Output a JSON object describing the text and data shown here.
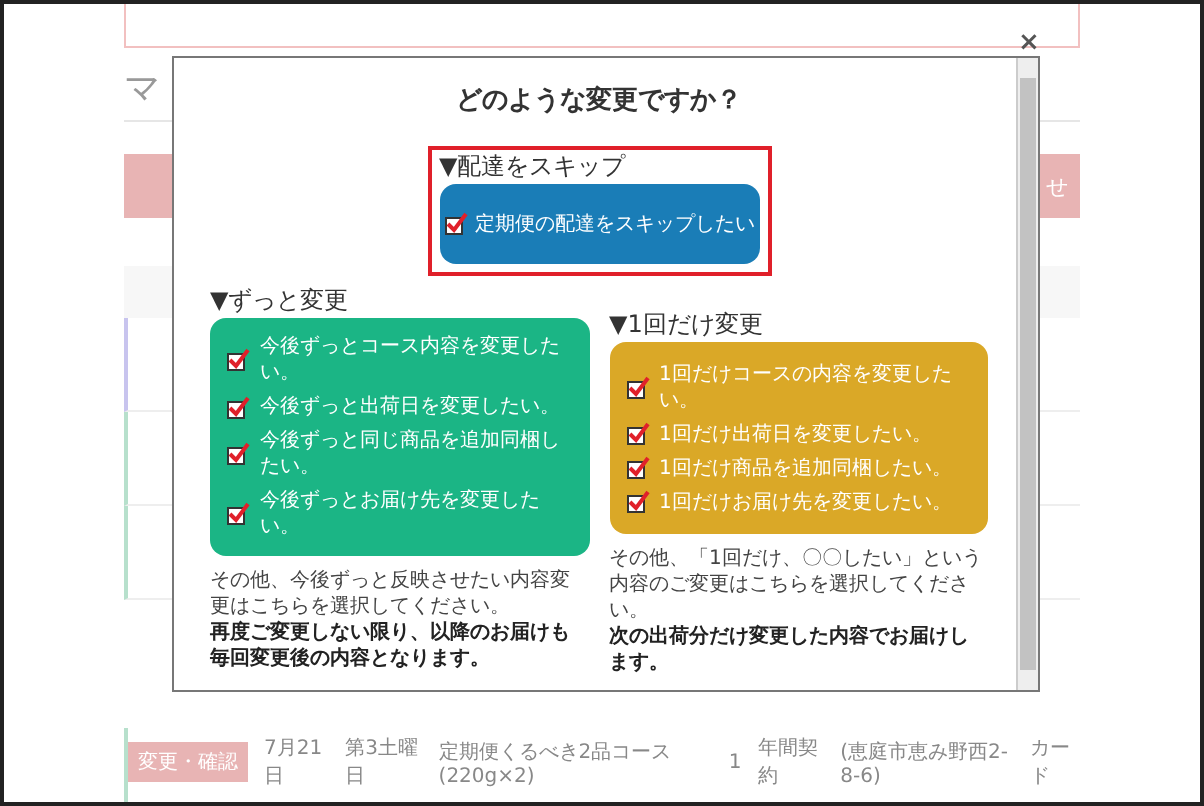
{
  "background": {
    "title": "マ",
    "side_button": "せ",
    "row": {
      "action": "変更・確認",
      "cells": [
        "7月21日",
        "第3土曜日",
        "定期便くるべき2品コース(220g×2)",
        "1",
        "年間契約",
        "(恵庭市恵み野西2-8-6)",
        "カード"
      ]
    }
  },
  "modal": {
    "title": "どのような変更ですか？",
    "close": "×",
    "skip": {
      "heading": "▼配達をスキップ",
      "highlighted": true,
      "option": {
        "label": "定期便の配達をスキップしたい",
        "checked": true
      }
    },
    "sections": [
      {
        "heading": "▼ずっと変更",
        "color": "#1bb585",
        "options": [
          {
            "label": "今後ずっとコース内容を変更したい。",
            "checked": true
          },
          {
            "label": "今後ずっと出荷日を変更したい。",
            "checked": true
          },
          {
            "label": "今後ずっと同じ商品を追加同梱したい。",
            "checked": true
          },
          {
            "label": "今後ずっとお届け先を変更したい。",
            "checked": true
          }
        ],
        "note": "その他、今後ずっと反映させたい内容変更はこちらを選択してください。",
        "note_bold": "再度ご変更しない限り、以降のお届けも毎回変更後の内容となります。"
      },
      {
        "heading": "▼1回だけ変更",
        "color": "#daa827",
        "options": [
          {
            "label": "1回だけコースの内容を変更したい。",
            "checked": true
          },
          {
            "label": "1回だけ出荷日を変更したい。",
            "checked": true
          },
          {
            "label": "1回だけ商品を追加同梱したい。",
            "checked": true
          },
          {
            "label": "1回だけお届け先を変更したい。",
            "checked": true
          }
        ],
        "note": "その他、「1回だけ、〇〇したい」という内容のご変更はこちらを選択してください。",
        "note_bold": "次の出荷分だけ変更した内容でお届けします。"
      }
    ]
  }
}
